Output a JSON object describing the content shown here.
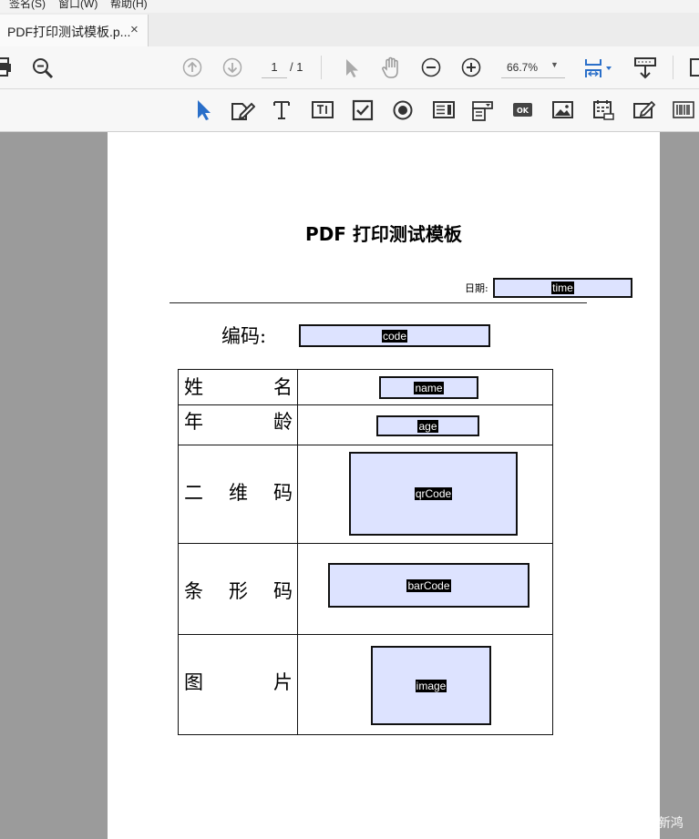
{
  "menu": {
    "items": [
      "签名(S)",
      "窗口(W)",
      "帮助(H)"
    ]
  },
  "tab": {
    "title": "PDF打印测试模板.p...",
    "close": "×"
  },
  "toolbar": {
    "page_current": "1",
    "page_total": "/ 1",
    "zoom": "66.7%",
    "zoom_caret": "▼"
  },
  "form_tools": [
    "select-tool",
    "edit-fields",
    "text-tool",
    "text-field",
    "checkbox",
    "radio-button",
    "list-box",
    "dropdown",
    "button",
    "image-field",
    "date-field",
    "signature-field",
    "barcode"
  ],
  "document": {
    "title": "PDF 打印测试模板",
    "date_label": "日期:",
    "date_field": "time",
    "code_label": "编码:",
    "code_field": "code",
    "rows": [
      {
        "label_left": "姓",
        "label_right": "名",
        "field": "name"
      },
      {
        "label_left": "年",
        "label_right": "龄",
        "field": "age"
      },
      {
        "label_left": "二",
        "label_mid": "维",
        "label_right": "码",
        "field": "qrCode"
      },
      {
        "label_left": "条",
        "label_mid": "形",
        "label_right": "码",
        "field": "barCode"
      },
      {
        "label_left": "图",
        "label_right": "片",
        "field": "image"
      }
    ]
  },
  "watermark": "CSDN @方新鸿",
  "colors": {
    "field_fill": "#dde3ff",
    "accent_blue": "#2a6fc9",
    "viewer_bg": "#9b9b9b"
  }
}
